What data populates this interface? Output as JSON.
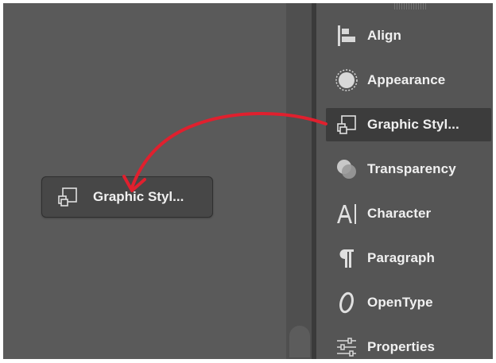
{
  "panel": {
    "items": [
      {
        "label": "Align",
        "icon": "align-icon"
      },
      {
        "label": "Appearance",
        "icon": "appearance-icon"
      },
      {
        "label": "Graphic Styl...",
        "icon": "graphic-styles-icon",
        "active": true
      },
      {
        "label": "Transparency",
        "icon": "transparency-icon"
      },
      {
        "label": "Character",
        "icon": "character-icon"
      },
      {
        "label": "Paragraph",
        "icon": "paragraph-icon"
      },
      {
        "label": "OpenType",
        "icon": "opentype-icon"
      },
      {
        "label": "Properties",
        "icon": "properties-icon"
      }
    ]
  },
  "dragged_panel": {
    "label": "Graphic Styl...",
    "icon": "graphic-styles-icon"
  },
  "colors": {
    "canvas": "#5a5a5a",
    "panel": "#555555",
    "active_item": "#3c3c3c",
    "text": "#f0f0f0",
    "arrow": "#e0202e"
  }
}
